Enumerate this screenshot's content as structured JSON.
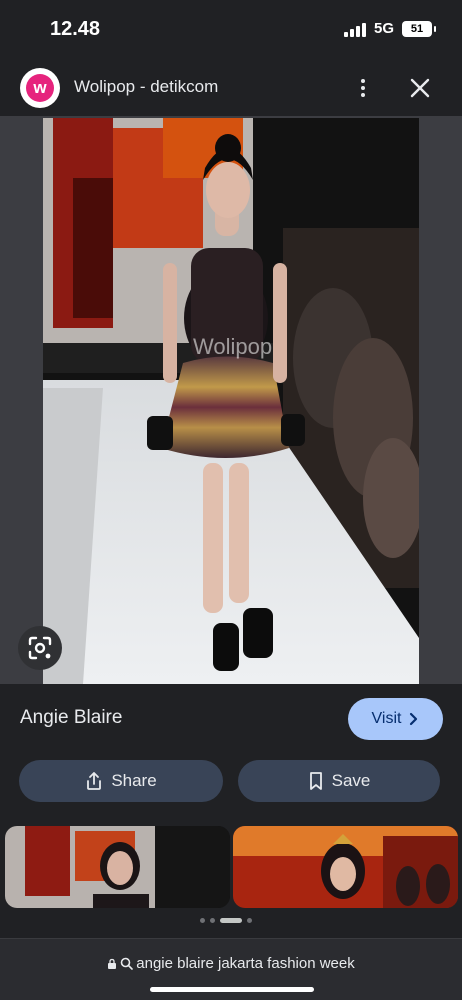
{
  "status_bar": {
    "time": "12.48",
    "network": "5G",
    "battery": "51"
  },
  "header": {
    "site_name": "Wolipop - detikcom",
    "logo_letter": "w"
  },
  "image": {
    "watermark": "Wolipop"
  },
  "result": {
    "title": "Angie Blaire",
    "visit_label": "Visit"
  },
  "actions": {
    "share_label": "Share",
    "save_label": "Save"
  },
  "url_bar": {
    "query": "angie blaire jakarta fashion week"
  },
  "colors": {
    "accent": "#a8c7fa",
    "action_bg": "#394457",
    "background": "#202124",
    "logo": "#e6237d"
  }
}
